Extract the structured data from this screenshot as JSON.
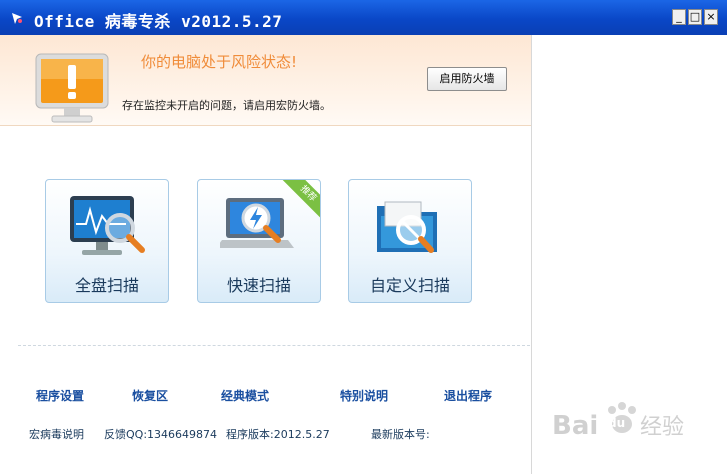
{
  "window": {
    "title": "Office 病毒专杀 v2012.5.27",
    "minimize": "_",
    "maximize": "□",
    "close": "×"
  },
  "banner": {
    "warning_title": "你的电脑处于风险状态!",
    "warning_text": "存在监控未开启的问题，请启用宏防火墙。",
    "firewall_button": "启用防火墙"
  },
  "scans": [
    {
      "label": "全盘扫描"
    },
    {
      "label": "快速扫描",
      "badge": "推荐"
    },
    {
      "label": "自定义扫描"
    }
  ],
  "links": [
    "程序设置",
    "恢复区",
    "经典模式",
    "特别说明",
    "退出程序"
  ],
  "footer": {
    "macro_virus_help": "宏病毒说明",
    "feedback": "反馈QQ:1346649874",
    "program_version": "程序版本:2012.5.27",
    "latest_version": "最新版本号:"
  },
  "watermark": {
    "text": "Baidu经验"
  },
  "colors": {
    "titlebar": "#0a47c7",
    "banner_title": "#f08c3a",
    "link": "#1a4fa0",
    "badge": "#7bc043"
  }
}
